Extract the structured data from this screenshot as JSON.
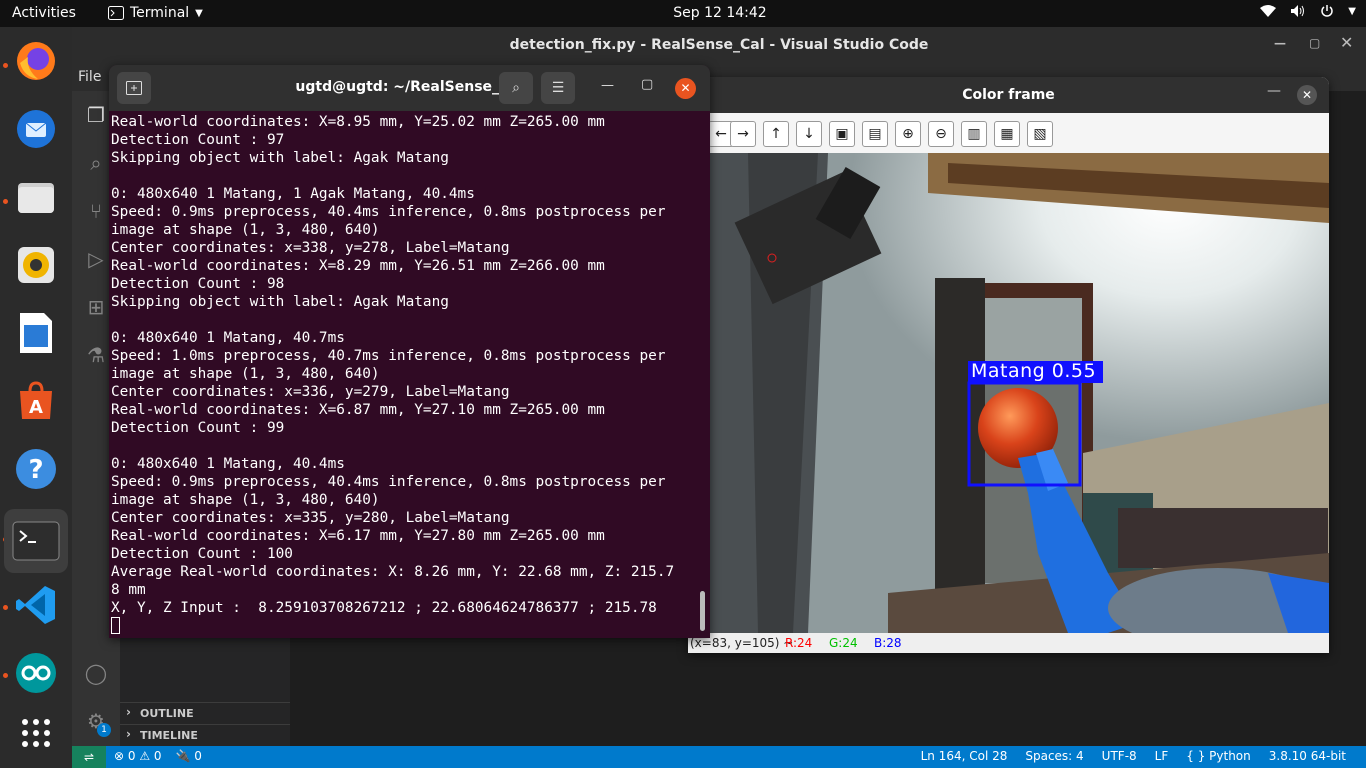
{
  "topbar": {
    "activities": "Activities",
    "app": "Terminal",
    "datetime": "Sep 12  14:42"
  },
  "vscode": {
    "title": "detection_fix.py - RealSense_Cal - Visual Studio Code",
    "menu_file": "File",
    "sections": {
      "outline": "OUTLINE",
      "timeline": "TIMELINE"
    },
    "status": {
      "errors": "⊗ 0 ⚠ 0",
      "ports": "🔌 0",
      "position": "Ln 164, Col 28",
      "spaces": "Spaces: 4",
      "encoding": "UTF-8",
      "eol": "LF",
      "language": "{ } Python",
      "interpreter": "3.8.10 64-bit"
    },
    "settings_badge": "1"
  },
  "terminal": {
    "title": "ugtd@ugtd: ~/RealSense_Cal",
    "lines": [
      "Real-world coordinates: X=8.95 mm, Y=25.02 mm Z=265.00 mm",
      "Detection Count : 97",
      "Skipping object with label: Agak Matang",
      "",
      "0: 480x640 1 Matang, 1 Agak Matang, 40.4ms",
      "Speed: 0.9ms preprocess, 40.4ms inference, 0.8ms postprocess per",
      "image at shape (1, 3, 480, 640)",
      "Center coordinates: x=338, y=278, Label=Matang",
      "Real-world coordinates: X=8.29 mm, Y=26.51 mm Z=266.00 mm",
      "Detection Count : 98",
      "Skipping object with label: Agak Matang",
      "",
      "0: 480x640 1 Matang, 40.7ms",
      "Speed: 1.0ms preprocess, 40.7ms inference, 0.8ms postprocess per",
      "image at shape (1, 3, 480, 640)",
      "Center coordinates: x=336, y=279, Label=Matang",
      "Real-world coordinates: X=6.87 mm, Y=27.10 mm Z=265.00 mm",
      "Detection Count : 99",
      "",
      "0: 480x640 1 Matang, 40.4ms",
      "Speed: 0.9ms preprocess, 40.4ms inference, 0.8ms postprocess per",
      "image at shape (1, 3, 480, 640)",
      "Center coordinates: x=335, y=280, Label=Matang",
      "Real-world coordinates: X=6.17 mm, Y=27.80 mm Z=265.00 mm",
      "Detection Count : 100",
      "Average Real-world coordinates: X: 8.26 mm, Y: 22.68 mm, Z: 215.7",
      "8 mm",
      "X, Y, Z Input :  8.259103708267212 ; 22.68064624786377 ; 215.78"
    ]
  },
  "colorframe": {
    "title": "Color frame",
    "detection_label": "Matang 0.55",
    "status_coords": "(x=83, y=105) ~",
    "status_r": "R:24",
    "status_g": "G:24",
    "status_b": "B:28",
    "colors": {
      "box": "#1010ff",
      "r": "#ff0000",
      "g": "#00c000",
      "b": "#0000ff"
    }
  },
  "dock": {
    "icons": [
      "firefox-icon",
      "thunderbird-icon",
      "files-icon",
      "rhythmbox-icon",
      "libreoffice-writer-icon",
      "app-center-icon",
      "help-icon",
      "terminal-icon",
      "vscode-icon",
      "arduino-icon",
      "show-apps-icon"
    ]
  }
}
